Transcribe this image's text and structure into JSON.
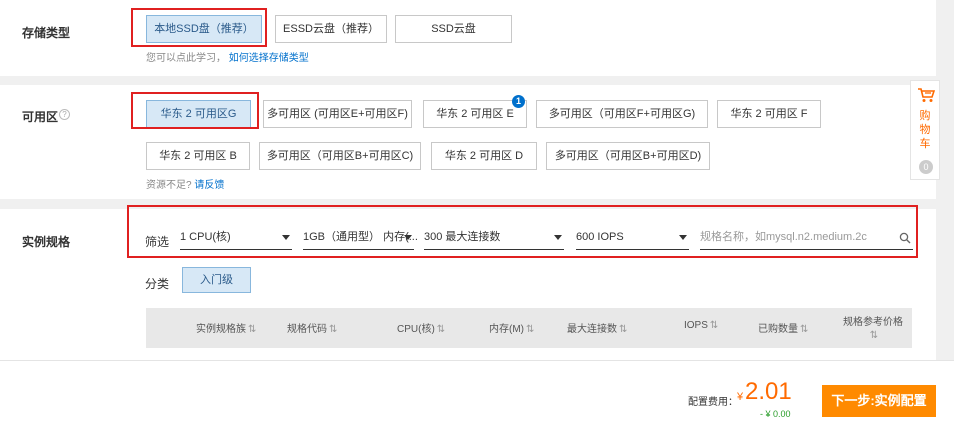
{
  "storage": {
    "label": "存储类型",
    "options": [
      "本地SSD盘（推荐）",
      "ESSD云盘（推荐）",
      "SSD云盘"
    ],
    "hint_text": "您可以点此学习，",
    "hint_link": "如何选择存储类型"
  },
  "zone": {
    "label": "可用区",
    "help": "?",
    "row1": [
      "华东 2 可用区G",
      "多可用区 (可用区E+可用区F)",
      "华东 2 可用区 E",
      "多可用区（可用区F+可用区G)",
      "华东 2 可用区 F"
    ],
    "row2": [
      "华东 2 可用区 B",
      "多可用区（可用区B+可用区C)",
      "华东 2 可用区 D",
      "多可用区（可用区B+可用区D)"
    ],
    "badge": "1",
    "hint_text": "资源不足?",
    "hint_link": "请反馈"
  },
  "spec": {
    "label": "实例规格",
    "filter_label": "筛选",
    "filters": [
      "1 CPU(核)",
      "1GB（通用型） 内存(...",
      "300 最大连接数",
      "600 IOPS"
    ],
    "search_placeholder": "规格名称，如mysql.n2.medium.2c",
    "category_label": "分类",
    "category": "入门级",
    "columns": [
      "实例规格族",
      "规格代码",
      "CPU(核)",
      "内存(M)",
      "最大连接数",
      "IOPS",
      "已购数量",
      "规格参考价格"
    ]
  },
  "cart": {
    "label": "购物车",
    "count": "0"
  },
  "footer": {
    "price_label": "配置费用：",
    "currency": "¥",
    "price": "2.01",
    "discount": "- ¥ 0.00",
    "next_button": "下一步:实例配置"
  },
  "colors": {
    "accent": "#0070cc",
    "selected_bg": "#d7e8f6",
    "highlight": "#e02020",
    "orange": "#ff8a00"
  }
}
